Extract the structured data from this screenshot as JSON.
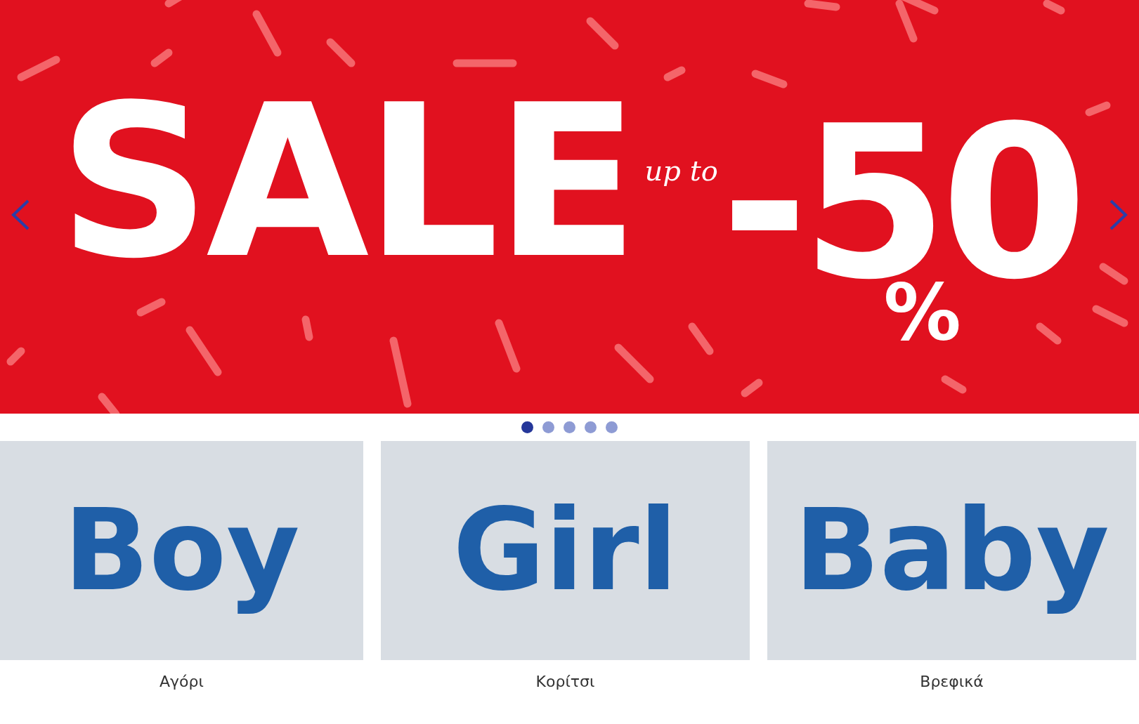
{
  "banner": {
    "headline": "SALE",
    "subline": "up to",
    "discount": "-50",
    "percent": "%"
  },
  "carousel": {
    "dots": [
      {
        "selected": true
      },
      {
        "selected": false
      },
      {
        "selected": false
      },
      {
        "selected": false
      },
      {
        "selected": false
      }
    ]
  },
  "categories": [
    {
      "image_text": "Boy",
      "label": "Αγόρι"
    },
    {
      "image_text": "Girl",
      "label": "Κορίτσι"
    },
    {
      "image_text": "Baby",
      "label": "Βρεφικά"
    }
  ]
}
